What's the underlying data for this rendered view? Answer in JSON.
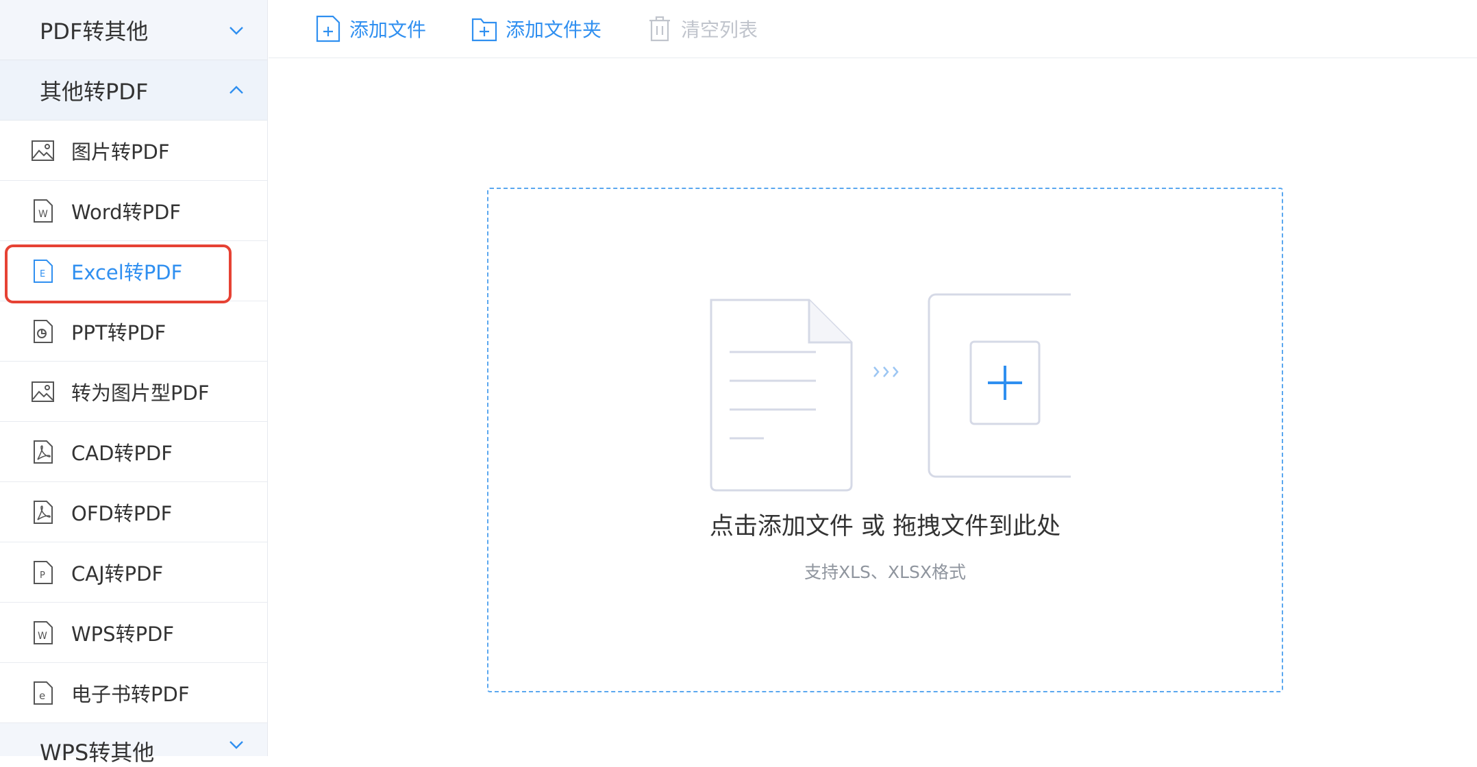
{
  "sidebar": {
    "groups": [
      {
        "label": "PDF转其他",
        "expanded": false
      },
      {
        "label": "其他转PDF",
        "expanded": true
      },
      {
        "label": "WPS转其他",
        "expanded": false
      }
    ],
    "items": [
      {
        "label": "图片转PDF",
        "icon": "image-icon"
      },
      {
        "label": "Word转PDF",
        "icon": "word-file-icon"
      },
      {
        "label": "Excel转PDF",
        "icon": "excel-file-icon",
        "active": true
      },
      {
        "label": "PPT转PDF",
        "icon": "ppt-file-icon"
      },
      {
        "label": "转为图片型PDF",
        "icon": "image-icon"
      },
      {
        "label": "CAD转PDF",
        "icon": "pdf-file-icon"
      },
      {
        "label": "OFD转PDF",
        "icon": "pdf-file-icon"
      },
      {
        "label": "CAJ转PDF",
        "icon": "p-file-icon"
      },
      {
        "label": "WPS转PDF",
        "icon": "wps-file-icon"
      },
      {
        "label": "电子书转PDF",
        "icon": "ebook-file-icon"
      }
    ]
  },
  "toolbar": {
    "add_file": "添加文件",
    "add_folder": "添加文件夹",
    "clear_list": "清空列表"
  },
  "dropzone": {
    "title": "点击添加文件 或 拖拽文件到此处",
    "subtitle": "支持XLS、XLSX格式"
  },
  "colors": {
    "accent": "#2f8ff0",
    "highlight": "#e64234",
    "sidebar_bg": "#f3f6fb",
    "disabled": "#c0c4cc"
  }
}
